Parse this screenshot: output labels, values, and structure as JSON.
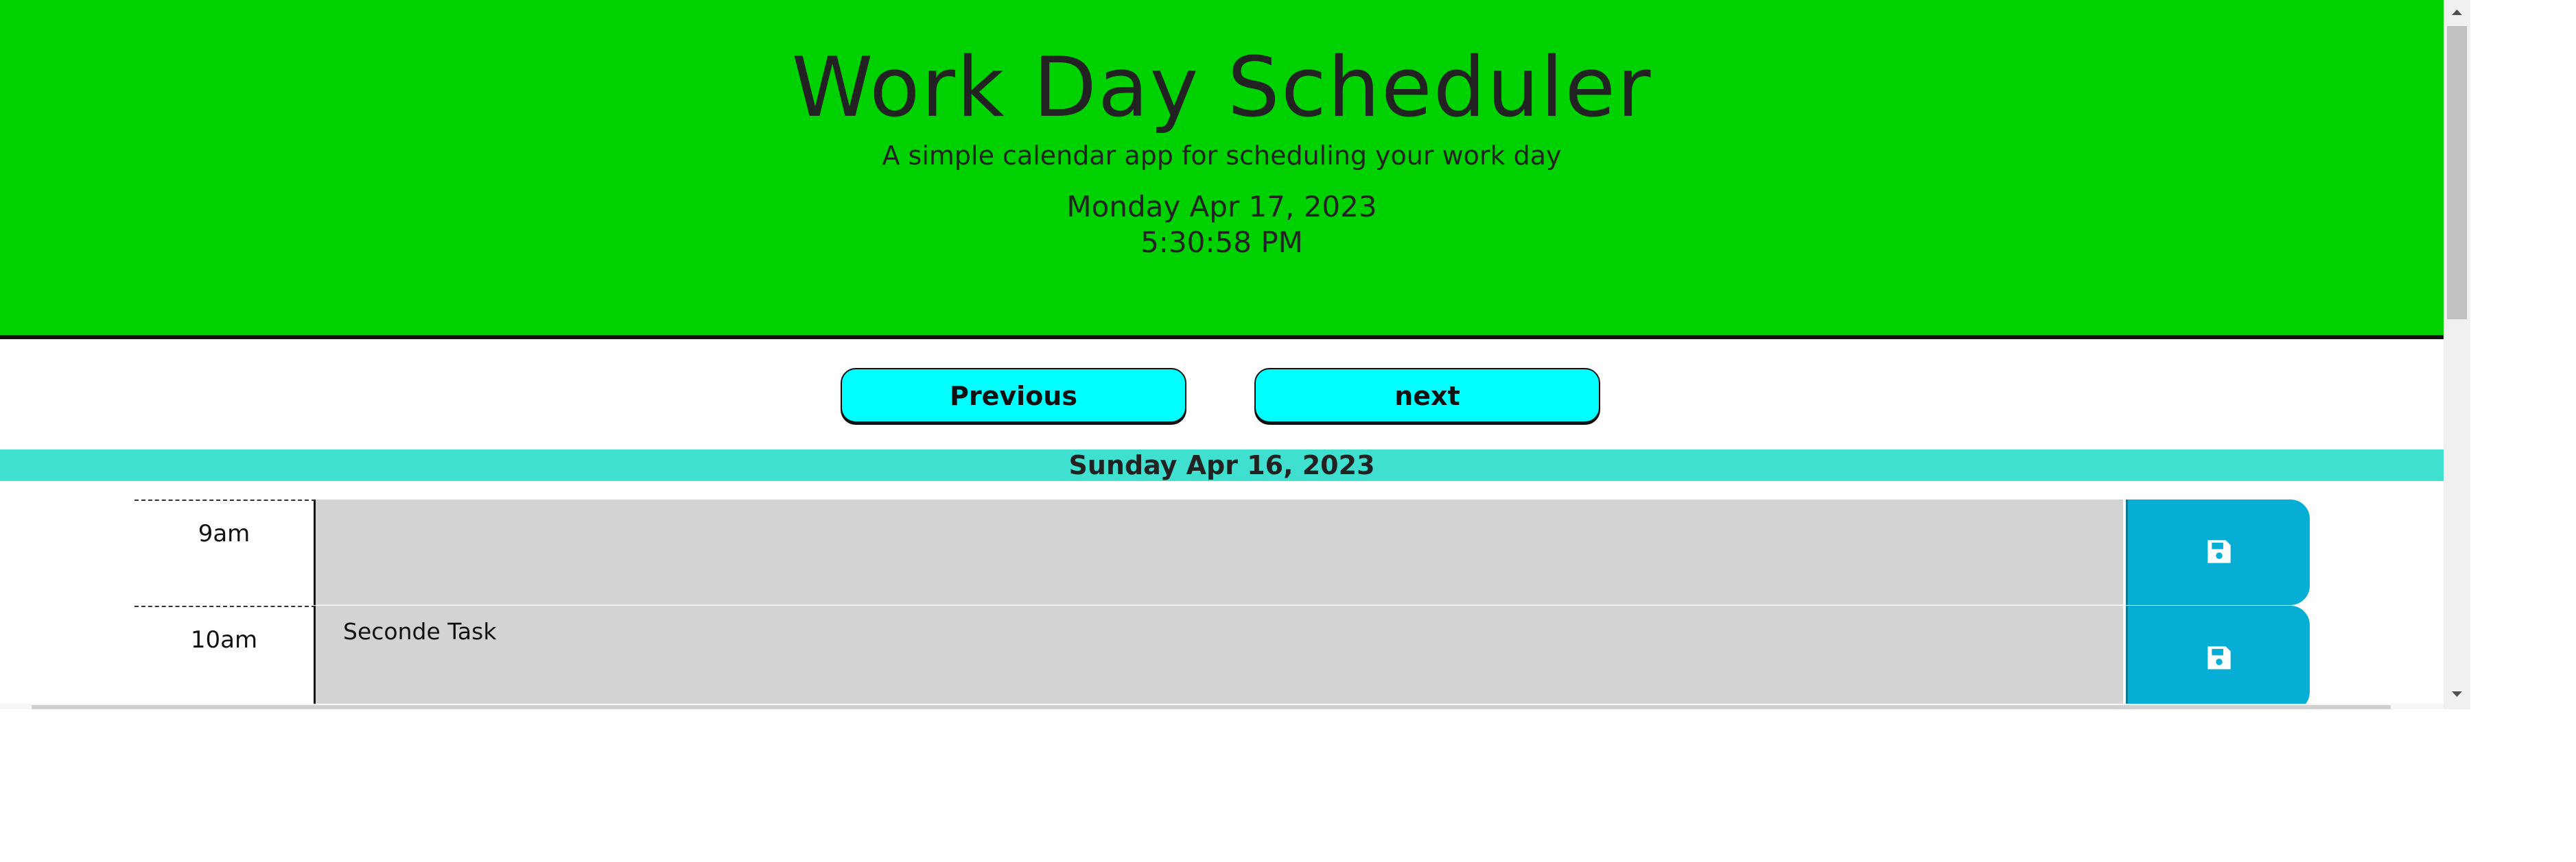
{
  "header": {
    "title": "Work Day Scheduler",
    "subtitle": "A simple calendar app for scheduling your work day",
    "current_date": "Monday Apr 17, 2023",
    "current_time": "5:30:58 PM"
  },
  "nav": {
    "previous_label": "Previous",
    "next_label": "next"
  },
  "day": {
    "label": "Sunday Apr 16, 2023"
  },
  "rows": [
    {
      "hour": "9am",
      "text": ""
    },
    {
      "hour": "10am",
      "text": "Seconde Task"
    }
  ],
  "icons": {
    "save": "save-icon",
    "scroll_up": "chevron-up-icon",
    "scroll_down": "chevron-down-icon"
  },
  "colors": {
    "header_bg": "#00d100",
    "nav_button_bg": "#00ffff",
    "day_bar_bg": "#40e0d0",
    "row_bg": "#d3d3d3",
    "save_button_bg": "#06aed5"
  }
}
